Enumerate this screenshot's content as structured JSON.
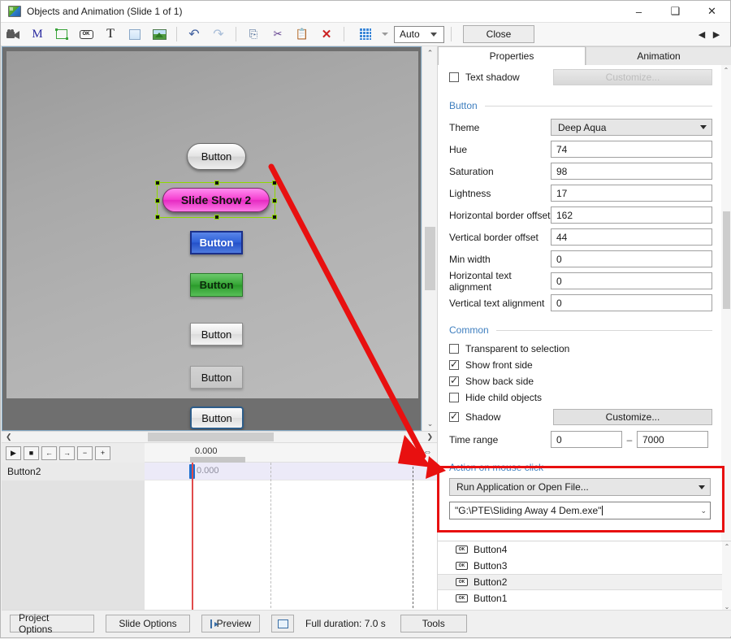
{
  "window": {
    "title": "Objects and Animation (Slide 1 of 1)",
    "app_icon": "app-image-icon",
    "minimize": "–",
    "maximize": "❐",
    "close": "✕"
  },
  "toolbar": {
    "items": [
      {
        "name": "camera-icon",
        "glyph": "🎥"
      },
      {
        "name": "mask-m-icon",
        "glyph": "M"
      },
      {
        "name": "frame-icon",
        "glyph": ""
      },
      {
        "name": "button-object-icon",
        "glyph": "OK"
      },
      {
        "name": "text-object-icon",
        "glyph": "T"
      },
      {
        "name": "rectangle-object-icon",
        "glyph": ""
      },
      {
        "name": "image-object-icon",
        "glyph": ""
      },
      {
        "name": "undo-icon",
        "glyph": "↶"
      },
      {
        "name": "redo-icon",
        "glyph": "↷"
      },
      {
        "name": "copy-icon",
        "glyph": "⎘"
      },
      {
        "name": "cut-icon",
        "glyph": "✂"
      },
      {
        "name": "paste-icon",
        "glyph": "📋"
      },
      {
        "name": "delete-icon",
        "glyph": "✕"
      },
      {
        "name": "grid-icon",
        "glyph": ""
      }
    ],
    "zoom_value": "Auto",
    "close_label": "Close",
    "nav_prev": "◀",
    "nav_next": "▶"
  },
  "canvas": {
    "objects": [
      {
        "name": "button-rounded-white",
        "label": "Button"
      },
      {
        "name": "button-selected-pink",
        "label": "Slide Show 2"
      },
      {
        "name": "button-blue",
        "label": "Button"
      },
      {
        "name": "button-green",
        "label": "Button"
      },
      {
        "name": "button-light-1",
        "label": "Button"
      },
      {
        "name": "button-flat-gray",
        "label": "Button"
      },
      {
        "name": "button-outlined-blue",
        "label": "Button"
      }
    ]
  },
  "timeline": {
    "controls": [
      "▶",
      "■",
      "←",
      "→",
      "−",
      "+"
    ],
    "ruler_time": "0.000",
    "row_label": "Button2",
    "row_time": "0.000",
    "collapse_icon": "⇔"
  },
  "panel": {
    "tabs": [
      {
        "label": "Properties",
        "active": true
      },
      {
        "label": "Animation",
        "active": false
      }
    ],
    "text_shadow": {
      "label": "Text shadow",
      "checked": false,
      "customize_label": "Customize..."
    },
    "section_button": "Button",
    "fields": [
      {
        "label": "Theme",
        "value": "Deep Aqua",
        "type": "dropdown"
      },
      {
        "label": "Hue",
        "value": "74",
        "type": "text"
      },
      {
        "label": "Saturation",
        "value": "98",
        "type": "text"
      },
      {
        "label": "Lightness",
        "value": "17",
        "type": "text"
      },
      {
        "label": "Horizontal border offset",
        "value": "162",
        "type": "text"
      },
      {
        "label": "Vertical border offset",
        "value": "44",
        "type": "text"
      },
      {
        "label": "Min width",
        "value": "0",
        "type": "text"
      },
      {
        "label": "Horizontal text alignment",
        "value": "0",
        "type": "text"
      },
      {
        "label": "Vertical text alignment",
        "value": "0",
        "type": "text"
      }
    ],
    "section_common": "Common",
    "checkboxes": [
      {
        "label": "Transparent to selection",
        "checked": false
      },
      {
        "label": "Show front side",
        "checked": true
      },
      {
        "label": "Show back side",
        "checked": true
      },
      {
        "label": "Hide child objects",
        "checked": false
      }
    ],
    "shadow": {
      "label": "Shadow",
      "checked": true,
      "customize_label": "Customize..."
    },
    "time_range": {
      "label": "Time range",
      "from": "0",
      "separator": "–",
      "to": "7000"
    },
    "section_action": "Action on mouse click",
    "action_type": "Run Application or Open File...",
    "action_path": "\"G:\\PTE\\Sliding Away 4 Dem.exe\"",
    "object_list": [
      {
        "label": "Button4",
        "selected": false
      },
      {
        "label": "Button3",
        "selected": false
      },
      {
        "label": "Button2",
        "selected": true
      },
      {
        "label": "Button1",
        "selected": false
      }
    ]
  },
  "bottom_bar": {
    "project_options": "Project Options",
    "slide_options": "Slide Options",
    "preview": "Preview",
    "duration": "Full duration: 7.0 s",
    "tools": "Tools"
  },
  "colors": {
    "accent_blue": "#3f7fbf",
    "annotation_red": "#e81010",
    "selected_button": "#f53fd0",
    "handle_green": "#8fd800"
  }
}
